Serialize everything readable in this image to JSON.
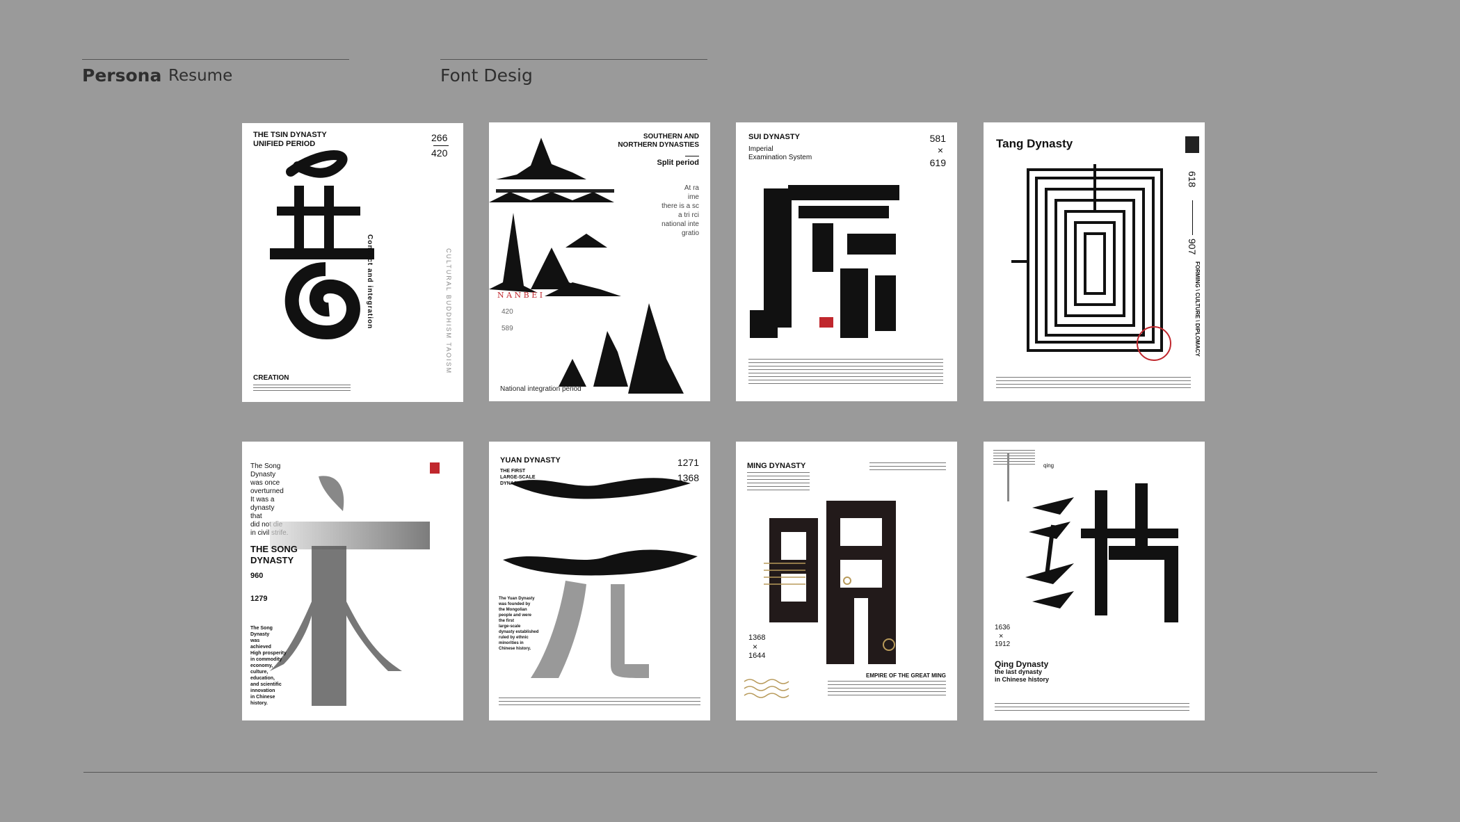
{
  "header": {
    "left_title": "Persona",
    "left_subtitle": "Resume",
    "right_title": "Font Desig"
  },
  "posters": {
    "jin": {
      "title1": "THE TSIN DYNASTY",
      "title2": "UNIFIED PERIOD",
      "year_start": "266",
      "year_end": "420",
      "side": "Conflict and integration",
      "right_vertical": "CULTURAL  BUDDHISM  TAOISM",
      "bottom_title": "CREATION"
    },
    "nanbei": {
      "title1": "SOUTHERN AND",
      "title2": "NORTHERN DYNASTIES",
      "subtitle": "Split period",
      "poem": [
        "At ra",
        "ime",
        "there is a sc",
        "a tri rci",
        "national inte",
        "gratio"
      ],
      "label": "N A N   B E I",
      "year_start": "420",
      "year_end": "589",
      "bottom": "National integration period"
    },
    "sui": {
      "title": "SUI DYNASTY",
      "sub1": "Imperial",
      "sub2": "Examination System",
      "year_start": "581",
      "year_end": "619",
      "cross": "×"
    },
    "tang": {
      "title": "Tang Dynasty",
      "year_start": "618",
      "year_end": "907",
      "right_vertical": "FORMING \\ CULTURE \\ DIPLOMACY"
    },
    "song": {
      "lines": [
        "The Song",
        "Dynasty",
        "was once",
        "overturned",
        "It was a",
        "dynasty",
        "that",
        "did not die",
        "in civil strife."
      ],
      "title1": "THE SONG",
      "title2": "DYNASTY",
      "year_start": "960",
      "year_end": "1279",
      "desc": [
        "The Song",
        "Dynasty",
        "was",
        "achieved",
        "High prosperity",
        "in commodity",
        "economy,",
        "culture,",
        "education,",
        "and scientific",
        "innovation",
        "in Chinese",
        "history."
      ]
    },
    "yuan": {
      "title": "YUAN DYNASTY",
      "sub": [
        "THE FIRST",
        "LARGE-SCALE",
        "DYNASTY"
      ],
      "year_start": "1271",
      "year_end": "1368",
      "desc": [
        "The Yuan Dynasty",
        "was founded by",
        "the Mongolian",
        "people and were",
        "the first",
        "large-scale",
        "dynasty established",
        "ruled by ethnic",
        "minorities in",
        "Chinese history."
      ]
    },
    "ming": {
      "title": "MING DYNASTY",
      "year_start": "1368",
      "year_end": "1644",
      "cross": "×",
      "bottom_title": "EMPIRE OF THE GREAT MING"
    },
    "qing": {
      "label": "qing",
      "year_start": "1636",
      "year_end": "1912",
      "cross": "×",
      "title": "Qing Dynasty",
      "sub1": "the last dynasty",
      "sub2": "in Chinese history"
    }
  },
  "colors": {
    "background": "#9a9a9a",
    "poster": "#ffffff",
    "ink": "#111111",
    "seal_red": "#c0272d",
    "gold": "#b89a5a"
  }
}
